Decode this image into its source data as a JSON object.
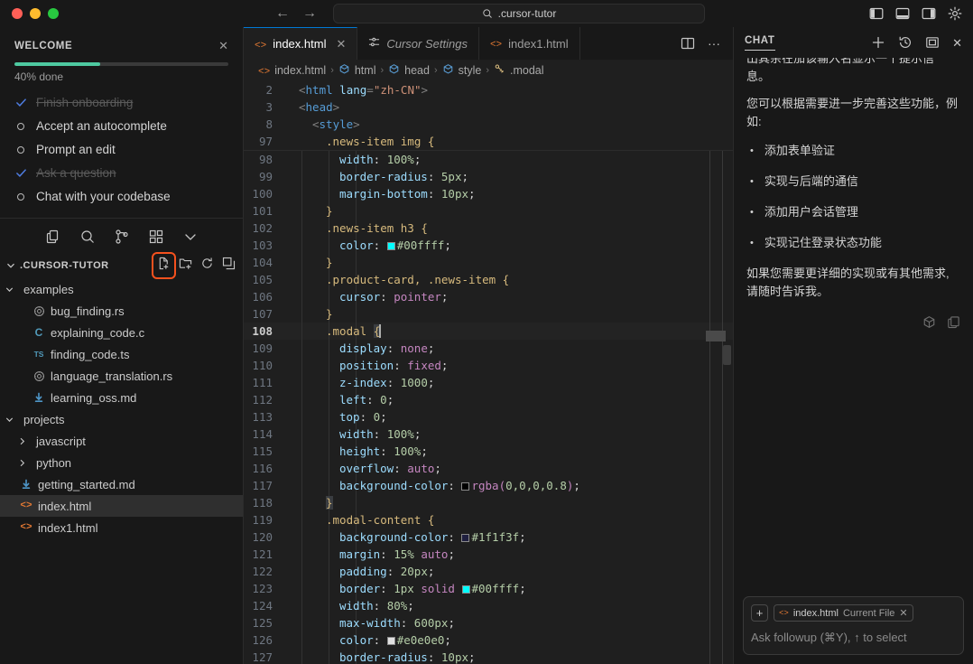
{
  "titlebar": {
    "search_value": ".cursor-tutor",
    "back_icon": "arrow-left-icon",
    "forward_icon": "arrow-right-icon",
    "search_icon": "search-icon",
    "actions": [
      {
        "name": "toggle-primary-sidebar-icon"
      },
      {
        "name": "toggle-panel-icon"
      },
      {
        "name": "toggle-secondary-sidebar-icon"
      },
      {
        "name": "gear-icon"
      }
    ]
  },
  "welcome": {
    "title": "WELCOME",
    "close_label": "✕",
    "progress_percent": 40,
    "progress_label": "40% done",
    "tasks": [
      {
        "label": "Finish onboarding",
        "done": true
      },
      {
        "label": "Accept an autocomplete",
        "done": false
      },
      {
        "label": "Prompt an edit",
        "done": false
      },
      {
        "label": "Ask a question",
        "done": true
      },
      {
        "label": "Chat with your codebase",
        "done": false
      }
    ]
  },
  "activitybar": {
    "items": [
      {
        "name": "explorer-icon",
        "active": true
      },
      {
        "name": "search-icon",
        "active": false
      },
      {
        "name": "source-control-icon",
        "active": false
      },
      {
        "name": "extensions-icon",
        "active": false
      },
      {
        "name": "chevron-down-icon",
        "active": false
      }
    ]
  },
  "explorer": {
    "title": ".CURSOR-TUTOR",
    "actions": [
      {
        "name": "new-file-icon",
        "highlighted": true
      },
      {
        "name": "new-folder-icon",
        "highlighted": false
      },
      {
        "name": "refresh-icon",
        "highlighted": false
      },
      {
        "name": "collapse-all-icon",
        "highlighted": false
      }
    ],
    "tree": [
      {
        "label": "examples",
        "type": "folder",
        "expanded": true,
        "depth": 1
      },
      {
        "label": "bug_finding.rs",
        "type": "rust",
        "depth": 2
      },
      {
        "label": "explaining_code.c",
        "type": "c",
        "depth": 2
      },
      {
        "label": "finding_code.ts",
        "type": "ts",
        "depth": 2
      },
      {
        "label": "language_translation.rs",
        "type": "rust",
        "depth": 2
      },
      {
        "label": "learning_oss.md",
        "type": "md",
        "depth": 2
      },
      {
        "label": "projects",
        "type": "folder",
        "expanded": true,
        "depth": 1
      },
      {
        "label": "javascript",
        "type": "folder",
        "expanded": false,
        "depth": 2
      },
      {
        "label": "python",
        "type": "folder",
        "expanded": false,
        "depth": 2
      },
      {
        "label": "getting_started.md",
        "type": "md",
        "depth": 1
      },
      {
        "label": "index.html",
        "type": "html",
        "depth": 1,
        "selected": true
      },
      {
        "label": "index1.html",
        "type": "html",
        "depth": 1
      }
    ]
  },
  "editor": {
    "tabs": [
      {
        "label": "index.html",
        "icon": "html-icon",
        "active": true,
        "closable": true,
        "italic": false
      },
      {
        "label": "Cursor Settings",
        "icon": "settings-sliders-icon",
        "active": false,
        "closable": false,
        "italic": true
      },
      {
        "label": "index1.html",
        "icon": "html-icon",
        "active": false,
        "closable": false,
        "italic": false
      }
    ],
    "tab_actions": [
      {
        "name": "split-editor-icon"
      },
      {
        "name": "more-actions-icon",
        "label": "···"
      }
    ],
    "breadcrumb": [
      {
        "label": "index.html",
        "icon": "html-icon"
      },
      {
        "label": "html",
        "icon": "symbol-element-icon"
      },
      {
        "label": "head",
        "icon": "symbol-element-icon"
      },
      {
        "label": "style",
        "icon": "symbol-element-icon"
      },
      {
        "label": ".modal",
        "icon": "symbol-ruler-icon"
      }
    ],
    "separator": "›",
    "active_line": 108,
    "lines": [
      {
        "n": 2,
        "sticky": true,
        "indent": 1,
        "tokens": [
          {
            "t": "<",
            "c": "punc"
          },
          {
            "t": "html",
            "c": "tag"
          },
          {
            "t": " ",
            "c": "white"
          },
          {
            "t": "lang",
            "c": "attr"
          },
          {
            "t": "=",
            "c": "punc"
          },
          {
            "t": "\"zh-CN\"",
            "c": "str"
          },
          {
            "t": ">",
            "c": "punc"
          }
        ]
      },
      {
        "n": 3,
        "sticky": true,
        "indent": 1,
        "tokens": [
          {
            "t": "<",
            "c": "punc"
          },
          {
            "t": "head",
            "c": "tag"
          },
          {
            "t": ">",
            "c": "punc"
          }
        ]
      },
      {
        "n": 8,
        "sticky": true,
        "indent": 2,
        "tokens": [
          {
            "t": "<",
            "c": "punc"
          },
          {
            "t": "style",
            "c": "tag"
          },
          {
            "t": ">",
            "c": "punc"
          }
        ]
      },
      {
        "n": 97,
        "sticky": true,
        "indent": 3,
        "tokens": [
          {
            "t": ".news-item img ",
            "c": "sel"
          },
          {
            "t": "{",
            "c": "brace"
          }
        ]
      },
      {
        "n": 98,
        "clipped": true,
        "indent": 4,
        "tokens": [
          {
            "t": "width",
            "c": "prop"
          },
          {
            "t": ": ",
            "c": "white"
          },
          {
            "t": "100%",
            "c": "num"
          },
          {
            "t": ";",
            "c": "white"
          }
        ]
      },
      {
        "n": 99,
        "indent": 4,
        "tokens": [
          {
            "t": "border-radius",
            "c": "prop"
          },
          {
            "t": ": ",
            "c": "white"
          },
          {
            "t": "5px",
            "c": "num"
          },
          {
            "t": ";",
            "c": "white"
          }
        ]
      },
      {
        "n": 100,
        "indent": 4,
        "tokens": [
          {
            "t": "margin-bottom",
            "c": "prop"
          },
          {
            "t": ": ",
            "c": "white"
          },
          {
            "t": "10px",
            "c": "num"
          },
          {
            "t": ";",
            "c": "white"
          }
        ]
      },
      {
        "n": 101,
        "indent": 3,
        "tokens": [
          {
            "t": "}",
            "c": "brace"
          }
        ]
      },
      {
        "n": 102,
        "indent": 3,
        "tokens": [
          {
            "t": ".news-item h3 ",
            "c": "sel"
          },
          {
            "t": "{",
            "c": "brace"
          }
        ]
      },
      {
        "n": 103,
        "indent": 4,
        "tokens": [
          {
            "t": "color",
            "c": "prop"
          },
          {
            "t": ": ",
            "c": "white"
          },
          {
            "t": "",
            "c": "swatch",
            "color": "#00ffff"
          },
          {
            "t": "#00ffff",
            "c": "num"
          },
          {
            "t": ";",
            "c": "white"
          }
        ]
      },
      {
        "n": 104,
        "indent": 3,
        "tokens": [
          {
            "t": "}",
            "c": "brace"
          }
        ]
      },
      {
        "n": 105,
        "indent": 3,
        "tokens": [
          {
            "t": ".product-card, .news-item ",
            "c": "sel"
          },
          {
            "t": "{",
            "c": "brace"
          }
        ]
      },
      {
        "n": 106,
        "indent": 4,
        "tokens": [
          {
            "t": "cursor",
            "c": "prop"
          },
          {
            "t": ": ",
            "c": "white"
          },
          {
            "t": "pointer",
            "c": "kw"
          },
          {
            "t": ";",
            "c": "white"
          }
        ]
      },
      {
        "n": 107,
        "indent": 3,
        "tokens": [
          {
            "t": "}",
            "c": "brace"
          }
        ]
      },
      {
        "n": 108,
        "indent": 3,
        "active": true,
        "tokens": [
          {
            "t": ".modal ",
            "c": "sel"
          },
          {
            "t": "{",
            "c": "brace-sel"
          },
          {
            "t": "",
            "c": "caret"
          }
        ]
      },
      {
        "n": 109,
        "indent": 4,
        "tokens": [
          {
            "t": "display",
            "c": "prop"
          },
          {
            "t": ": ",
            "c": "white"
          },
          {
            "t": "none",
            "c": "kw"
          },
          {
            "t": ";",
            "c": "white"
          }
        ]
      },
      {
        "n": 110,
        "indent": 4,
        "tokens": [
          {
            "t": "position",
            "c": "prop"
          },
          {
            "t": ": ",
            "c": "white"
          },
          {
            "t": "fixed",
            "c": "kw"
          },
          {
            "t": ";",
            "c": "white"
          }
        ]
      },
      {
        "n": 111,
        "indent": 4,
        "tokens": [
          {
            "t": "z-index",
            "c": "prop"
          },
          {
            "t": ": ",
            "c": "white"
          },
          {
            "t": "1000",
            "c": "num"
          },
          {
            "t": ";",
            "c": "white"
          }
        ]
      },
      {
        "n": 112,
        "indent": 4,
        "tokens": [
          {
            "t": "left",
            "c": "prop"
          },
          {
            "t": ": ",
            "c": "white"
          },
          {
            "t": "0",
            "c": "num"
          },
          {
            "t": ";",
            "c": "white"
          }
        ]
      },
      {
        "n": 113,
        "indent": 4,
        "tokens": [
          {
            "t": "top",
            "c": "prop"
          },
          {
            "t": ": ",
            "c": "white"
          },
          {
            "t": "0",
            "c": "num"
          },
          {
            "t": ";",
            "c": "white"
          }
        ]
      },
      {
        "n": 114,
        "indent": 4,
        "tokens": [
          {
            "t": "width",
            "c": "prop"
          },
          {
            "t": ": ",
            "c": "white"
          },
          {
            "t": "100%",
            "c": "num"
          },
          {
            "t": ";",
            "c": "white"
          }
        ]
      },
      {
        "n": 115,
        "indent": 4,
        "tokens": [
          {
            "t": "height",
            "c": "prop"
          },
          {
            "t": ": ",
            "c": "white"
          },
          {
            "t": "100%",
            "c": "num"
          },
          {
            "t": ";",
            "c": "white"
          }
        ]
      },
      {
        "n": 116,
        "indent": 4,
        "tokens": [
          {
            "t": "overflow",
            "c": "prop"
          },
          {
            "t": ": ",
            "c": "white"
          },
          {
            "t": "auto",
            "c": "kw"
          },
          {
            "t": ";",
            "c": "white"
          }
        ]
      },
      {
        "n": 117,
        "indent": 4,
        "tokens": [
          {
            "t": "background-color",
            "c": "prop"
          },
          {
            "t": ": ",
            "c": "white"
          },
          {
            "t": "",
            "c": "swatch",
            "color": "#000000"
          },
          {
            "t": "rgba(",
            "c": "kw"
          },
          {
            "t": "0,0,0,0.8",
            "c": "num"
          },
          {
            "t": ")",
            "c": "kw"
          },
          {
            "t": ";",
            "c": "white"
          }
        ]
      },
      {
        "n": 118,
        "indent": 3,
        "tokens": [
          {
            "t": "}",
            "c": "brace-sel"
          }
        ]
      },
      {
        "n": 119,
        "indent": 3,
        "tokens": [
          {
            "t": ".modal-content ",
            "c": "sel"
          },
          {
            "t": "{",
            "c": "brace"
          }
        ]
      },
      {
        "n": 120,
        "indent": 4,
        "tokens": [
          {
            "t": "background-color",
            "c": "prop"
          },
          {
            "t": ": ",
            "c": "white"
          },
          {
            "t": "",
            "c": "swatch",
            "color": "#1f1f3f"
          },
          {
            "t": "#1f1f3f",
            "c": "num"
          },
          {
            "t": ";",
            "c": "white"
          }
        ]
      },
      {
        "n": 121,
        "indent": 4,
        "tokens": [
          {
            "t": "margin",
            "c": "prop"
          },
          {
            "t": ": ",
            "c": "white"
          },
          {
            "t": "15%",
            "c": "num"
          },
          {
            "t": " ",
            "c": "white"
          },
          {
            "t": "auto",
            "c": "kw"
          },
          {
            "t": ";",
            "c": "white"
          }
        ]
      },
      {
        "n": 122,
        "indent": 4,
        "tokens": [
          {
            "t": "padding",
            "c": "prop"
          },
          {
            "t": ": ",
            "c": "white"
          },
          {
            "t": "20px",
            "c": "num"
          },
          {
            "t": ";",
            "c": "white"
          }
        ]
      },
      {
        "n": 123,
        "indent": 4,
        "tokens": [
          {
            "t": "border",
            "c": "prop"
          },
          {
            "t": ": ",
            "c": "white"
          },
          {
            "t": "1px",
            "c": "num"
          },
          {
            "t": " ",
            "c": "white"
          },
          {
            "t": "solid",
            "c": "kw"
          },
          {
            "t": " ",
            "c": "white"
          },
          {
            "t": "",
            "c": "swatch",
            "color": "#00ffff"
          },
          {
            "t": "#00ffff",
            "c": "num"
          },
          {
            "t": ";",
            "c": "white"
          }
        ]
      },
      {
        "n": 124,
        "indent": 4,
        "tokens": [
          {
            "t": "width",
            "c": "prop"
          },
          {
            "t": ": ",
            "c": "white"
          },
          {
            "t": "80%",
            "c": "num"
          },
          {
            "t": ";",
            "c": "white"
          }
        ]
      },
      {
        "n": 125,
        "indent": 4,
        "tokens": [
          {
            "t": "max-width",
            "c": "prop"
          },
          {
            "t": ": ",
            "c": "white"
          },
          {
            "t": "600px",
            "c": "num"
          },
          {
            "t": ";",
            "c": "white"
          }
        ]
      },
      {
        "n": 126,
        "indent": 4,
        "tokens": [
          {
            "t": "color",
            "c": "prop"
          },
          {
            "t": ": ",
            "c": "white"
          },
          {
            "t": "",
            "c": "swatch",
            "color": "#e0e0e0"
          },
          {
            "t": "#e0e0e0",
            "c": "num"
          },
          {
            "t": ";",
            "c": "white"
          }
        ]
      },
      {
        "n": 127,
        "indent": 4,
        "tokens": [
          {
            "t": "border-radius",
            "c": "prop"
          },
          {
            "t": ": ",
            "c": "white"
          },
          {
            "t": "10px",
            "c": "num"
          },
          {
            "t": ";",
            "c": "white"
          }
        ]
      }
    ]
  },
  "chat": {
    "title": "CHAT",
    "actions": [
      {
        "name": "new-chat-icon",
        "label": "+"
      },
      {
        "name": "history-icon"
      },
      {
        "name": "maximize-icon"
      },
      {
        "name": "close-icon",
        "label": "✕"
      }
    ],
    "clipped_text": "出其余在加该输入名显示一个提示信",
    "clipped_text_2": "息。",
    "paragraph_1": "您可以根据需要进一步完善这些功能，例如:",
    "bullets": [
      "添加表单验证",
      "实现与后端的通信",
      "添加用户会话管理",
      "实现记住登录状态功能"
    ],
    "paragraph_2": "如果您需要更详细的实现或有其他需求,请随时告诉我。",
    "message_actions": [
      {
        "name": "model-cube-icon"
      },
      {
        "name": "copy-icon"
      }
    ],
    "input": {
      "add_context_label": "+",
      "chip_file": "index.html",
      "chip_context": "Current File",
      "chip_close": "✕",
      "placeholder": "Ask followup (⌘Y), ↑ to select"
    }
  }
}
